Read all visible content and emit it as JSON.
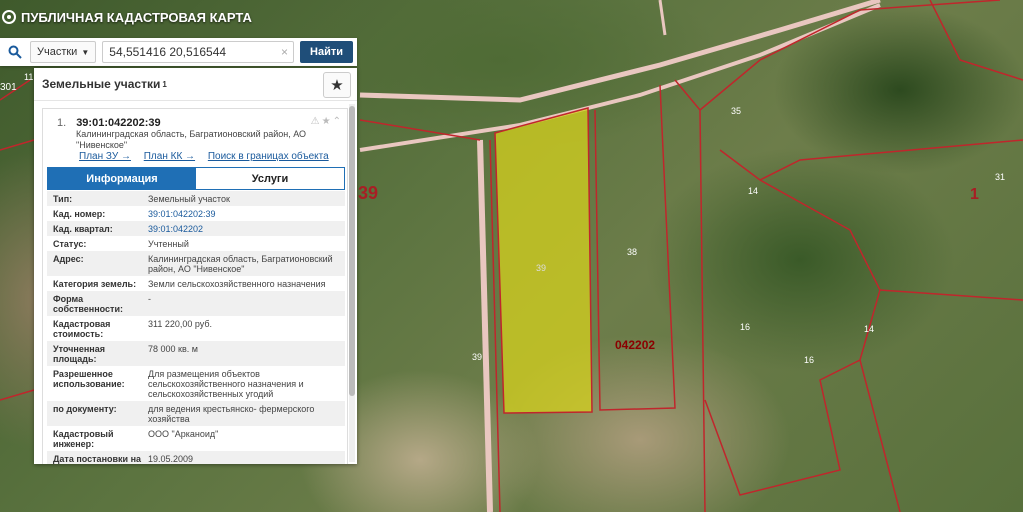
{
  "app": {
    "title": "ПУБЛИЧНАЯ КАДАСТРОВАЯ КАРТА"
  },
  "search": {
    "type_label": "Участки",
    "query": "54,551416 20,516544",
    "find_label": "Найти",
    "clear_glyph": "×"
  },
  "panel": {
    "header": "Земельные участки",
    "header_count": "1",
    "result": {
      "index": "1.",
      "cad_number": "39:01:042202:39",
      "address": "Калининградская область, Багратионовский район, АО \"Нивенское\"",
      "links": [
        "План ЗУ →",
        "План КК →",
        "Поиск в границах объекта →"
      ],
      "tabs": {
        "info": "Информация",
        "services": "Услуги"
      },
      "fields": [
        {
          "k": "Тип:",
          "v": "Земельный участок"
        },
        {
          "k": "Кад. номер:",
          "v": "39:01:042202:39"
        },
        {
          "k": "Кад. квартал:",
          "v": "39:01:042202"
        },
        {
          "k": "Статус:",
          "v": "Учтенный"
        },
        {
          "k": "Адрес:",
          "v": "Калининградская область, Багратионовский район, АО \"Нивенское\""
        },
        {
          "k": "Категория земель:",
          "v": "Земли сельскохозяйственного назначения"
        },
        {
          "k": "Форма собственности:",
          "v": "-"
        },
        {
          "k": "Кадастровая стоимость:",
          "v": "311 220,00 руб."
        },
        {
          "k": "Уточненная площадь:",
          "v": "78 000 кв. м"
        },
        {
          "k": "Разрешенное использование:",
          "v": "Для размещения объектов сельскохозяйственного назначения и сельскохозяйственных угодий"
        },
        {
          "k": "по документу:",
          "v": "для ведения крестьянско- фермерского хозяйства"
        },
        {
          "k": "Кадастровый инженер:",
          "v": "ООО \"Арканоид\""
        },
        {
          "k": "Дата постановки на учет:",
          "v": "19.05.2009"
        }
      ]
    }
  },
  "map": {
    "labels": [
      "39",
      "38",
      "35",
      "14",
      "16",
      "16",
      "14",
      "31",
      "1",
      "042202",
      "39",
      "39",
      "301",
      "11"
    ]
  },
  "colors": {
    "accent": "#1f6fb5",
    "button": "#1f4e79",
    "parcel_fill": "#d6d21e",
    "boundary": "#c0262c"
  }
}
